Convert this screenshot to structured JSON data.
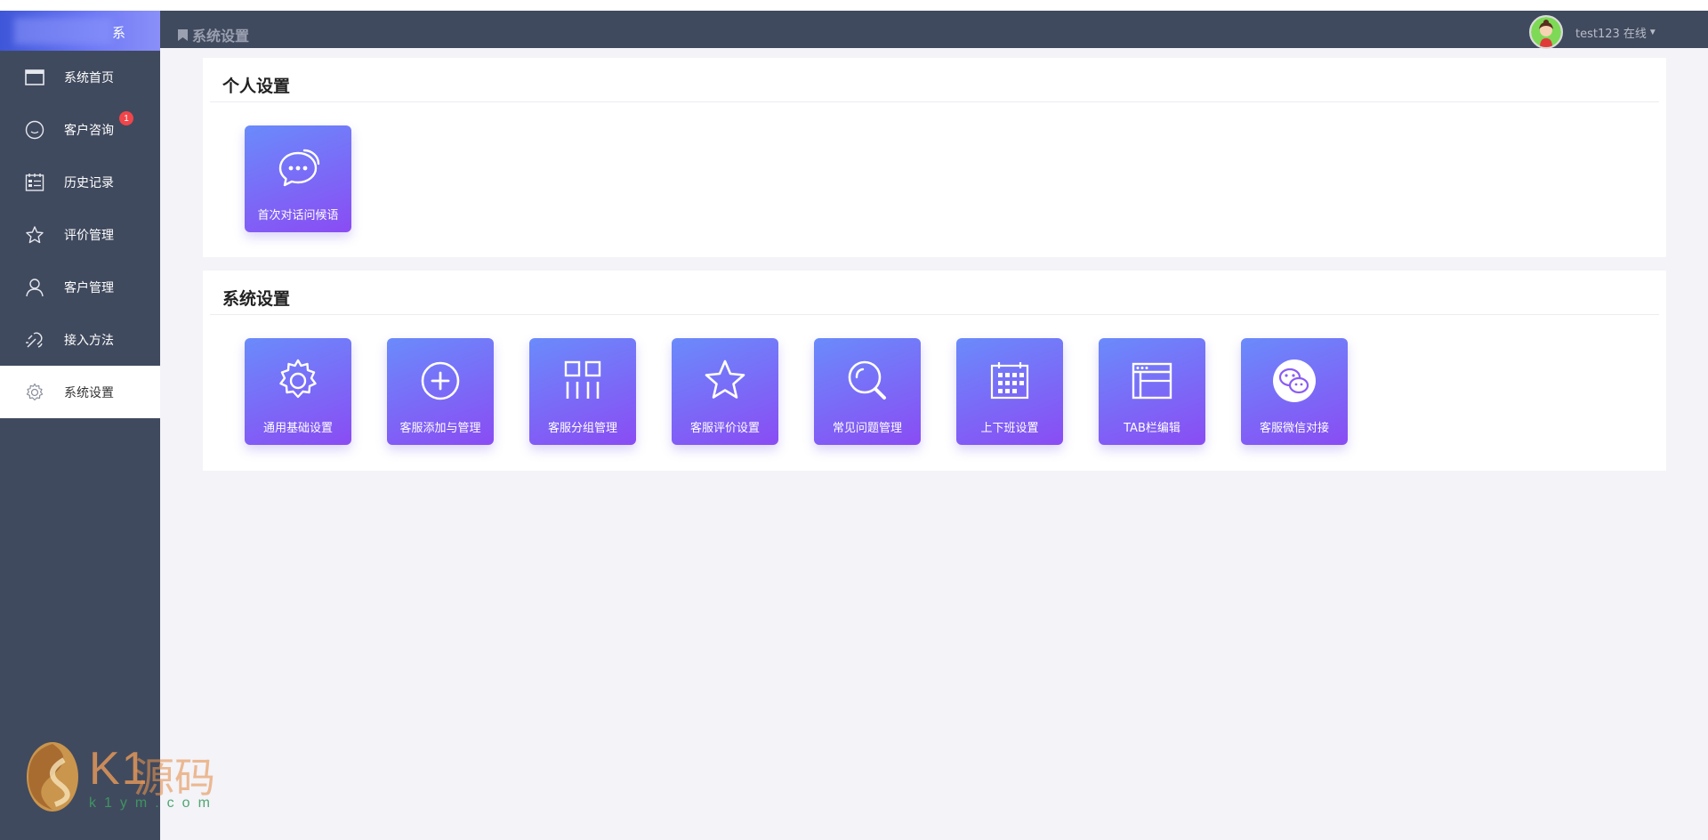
{
  "sidebar": {
    "logo_text": "系",
    "items": [
      {
        "label": "系统首页",
        "icon": "window-icon"
      },
      {
        "label": "客户咨询",
        "icon": "smile-icon",
        "badge": "1"
      },
      {
        "label": "历史记录",
        "icon": "list-icon"
      },
      {
        "label": "评价管理",
        "icon": "star-icon"
      },
      {
        "label": "客户管理",
        "icon": "user-icon"
      },
      {
        "label": "接入方法",
        "icon": "plug-icon"
      },
      {
        "label": "系统设置",
        "icon": "gear-icon",
        "active": true
      }
    ]
  },
  "header": {
    "breadcrumb": "系统设置",
    "user_label": "test123 在线"
  },
  "personal": {
    "title": "个人设置",
    "tiles": [
      {
        "label": "首次对话问候语",
        "icon": "chat-bubble-icon"
      }
    ]
  },
  "system": {
    "title": "系统设置",
    "tiles": [
      {
        "label": "通用基础设置",
        "icon": "gear-icon"
      },
      {
        "label": "客服添加与管理",
        "icon": "plus-circle-icon"
      },
      {
        "label": "客服分组管理",
        "icon": "group-icon"
      },
      {
        "label": "客服评价设置",
        "icon": "star-icon"
      },
      {
        "label": "常见问题管理",
        "icon": "search-icon"
      },
      {
        "label": "上下班设置",
        "icon": "calendar-icon"
      },
      {
        "label": "TAB栏编辑",
        "icon": "browser-window-icon"
      },
      {
        "label": "客服微信对接",
        "icon": "wechat-icon"
      }
    ]
  },
  "watermark": {
    "brand": "K1",
    "cn": "源码",
    "url": "k1ym.com"
  },
  "colors": {
    "sidebar_bg": "#404a5e",
    "tile_gradient_start": "#6a8bfb",
    "tile_gradient_end": "#8a4cf3",
    "badge": "#f0454a"
  }
}
